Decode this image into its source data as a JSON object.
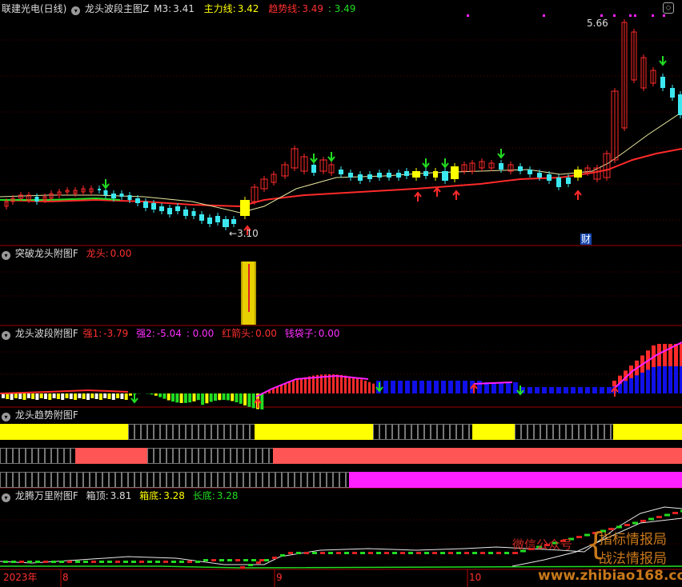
{
  "main_header": {
    "stock": "联建光电(日线)",
    "indicator": "龙头波段主图Z",
    "m3_label": "M3:",
    "m3_value": "3.41",
    "main_label": "主力线:",
    "main_value": "3.42",
    "trend_label": "趋势线:",
    "trend_value": "3.49",
    "trend_value2": ": 3.49"
  },
  "price_labels": {
    "high": "5.66",
    "low": "3.10",
    "cai": "财"
  },
  "panel1": {
    "title": "突破龙头附图F",
    "label": "龙头:",
    "value": "0.00"
  },
  "panel2": {
    "title": "龙头波段附图F",
    "s1_label": "强1:",
    "s1_value": "-3.79",
    "s2_label": "强2:",
    "s2_value": "-5.04",
    "s3_value": ": 0.00",
    "red_label": "红箭头:",
    "red_value": "0.00",
    "bag_label": "钱袋子:",
    "bag_value": "0.00"
  },
  "panel3": {
    "title": "龙头趋势附图F"
  },
  "panel4": {
    "title": "龙腾万里附图F",
    "top_label": "箱顶:",
    "top_value": "3.81",
    "bottom_label": "箱底:",
    "bottom_value": "3.28",
    "long_label": "长底:",
    "long_value": "3.28"
  },
  "axis": {
    "year": "2023年",
    "m8": "8",
    "m9": "9",
    "m10": "10"
  },
  "watermark": {
    "wechat": "微信公众号",
    "line1": "指标情报局",
    "line2": "战法情报局",
    "site": "www.zhibiao168.com"
  },
  "colors": {
    "background": "#000000",
    "red": "#ff2a2a",
    "cyan": "#3ce8f0",
    "yellow": "#ffff00",
    "magenta": "#ff20ff",
    "blue": "#1010e8",
    "green": "#22dd22"
  }
}
